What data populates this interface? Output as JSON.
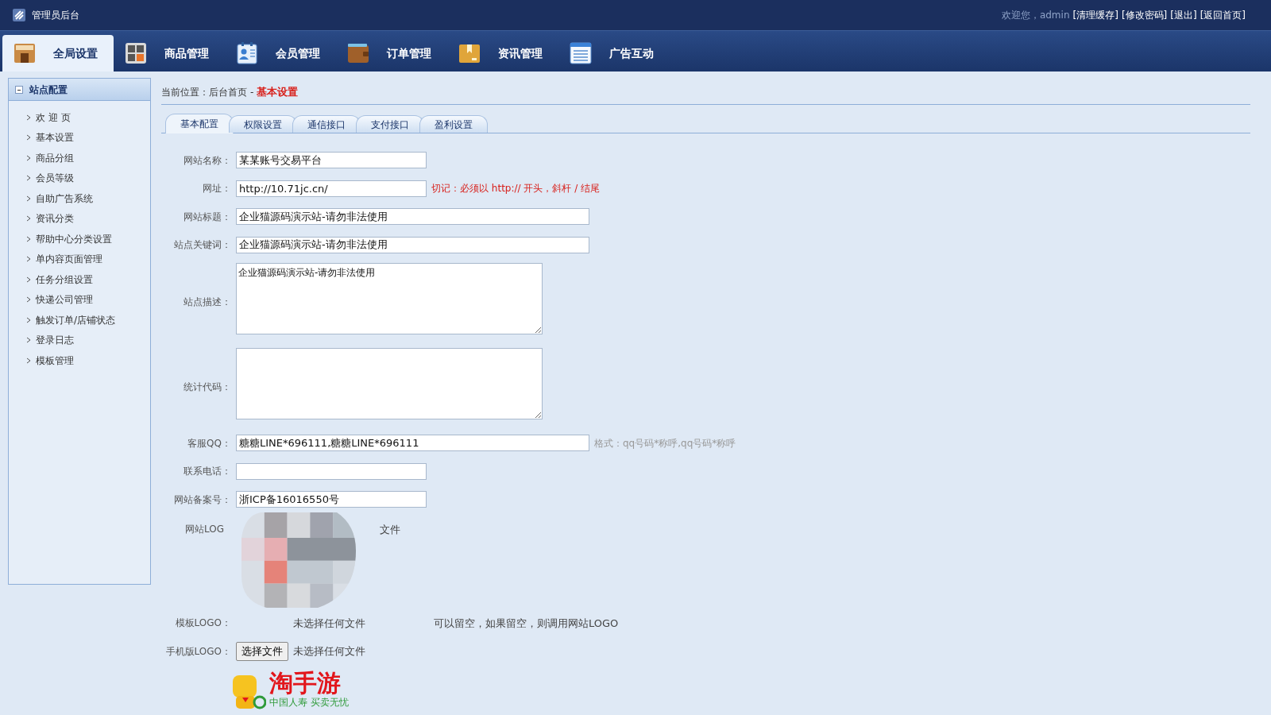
{
  "header": {
    "title": "管理员后台",
    "welcome": "欢迎您，admin",
    "links": [
      "[清理缓存]",
      "[修改密码]",
      "[退出]",
      "[返回首页]"
    ]
  },
  "nav_tabs": [
    {
      "label": "全局设置",
      "selected": true
    },
    {
      "label": "商品管理",
      "selected": false
    },
    {
      "label": "会员管理",
      "selected": false
    },
    {
      "label": "订单管理",
      "selected": false
    },
    {
      "label": "资讯管理",
      "selected": false
    },
    {
      "label": "广告互动",
      "selected": false
    }
  ],
  "sidebar": {
    "title": "站点配置",
    "expanded": true,
    "items": [
      "欢 迎 页",
      "基本设置",
      "商品分组",
      "会员等级",
      "自助广告系统",
      "资讯分类",
      "帮助中心分类设置",
      "单内容页面管理",
      "任务分组设置",
      "快递公司管理",
      "触发订单/店铺状态",
      "登录日志",
      "模板管理"
    ]
  },
  "breadcrumb": {
    "prefix": "当前位置：",
    "home": "后台首页",
    "separator": "-",
    "current": "基本设置"
  },
  "sub_tabs": [
    {
      "label": "基本配置",
      "selected": true
    },
    {
      "label": "权限设置",
      "selected": false
    },
    {
      "label": "通信接口",
      "selected": false
    },
    {
      "label": "支付接口",
      "selected": false
    },
    {
      "label": "盈利设置",
      "selected": false
    }
  ],
  "form": [
    {
      "kind": "text",
      "label": "网站名称：",
      "value": "某某账号交易平台",
      "wide": false
    },
    {
      "kind": "text",
      "label": "网址：",
      "value": "http://10.71jc.cn/",
      "wide": false,
      "note": "切记：必须以 http:// 开头，斜杆 / 结尾",
      "warning": true
    },
    {
      "kind": "text",
      "label": "网站标题：",
      "value": "企业猫源码演示站-请勿非法使用",
      "wide": true
    },
    {
      "kind": "text",
      "label": "站点关键词：",
      "value": "企业猫源码演示站-请勿非法使用",
      "wide": true
    },
    {
      "kind": "textarea",
      "label": "站点描述：",
      "value": "企业猫源码演示站-请勿非法使用"
    },
    {
      "kind": "textarea",
      "label": "统计代码："
    },
    {
      "kind": "text",
      "label": "客服QQ：",
      "value": "糖糖LINE*696111,糖糖LINE*696111",
      "wide": true,
      "note": "格式：qq号码*称呼,qq号码*称呼",
      "warning": false
    },
    {
      "kind": "text",
      "label": "联系电话：",
      "wide": false
    },
    {
      "kind": "text",
      "label": "网站备案号：",
      "value": "浙ICP备16016550号",
      "wide": false
    },
    {
      "kind": "covered",
      "label": "网站LOG",
      "tail": "文件"
    },
    {
      "kind": "file",
      "label": "模板LOGO：",
      "status": "未选择任何文件",
      "note": "可以留空，如果留空，则调用网站LOGO"
    },
    {
      "kind": "file",
      "label": "手机版LOGO：",
      "button": "选择文件",
      "status": "未选择任何文件"
    }
  ],
  "logo": {
    "name": "淘手游",
    "slogan": "中国人寿 买卖无忧"
  }
}
